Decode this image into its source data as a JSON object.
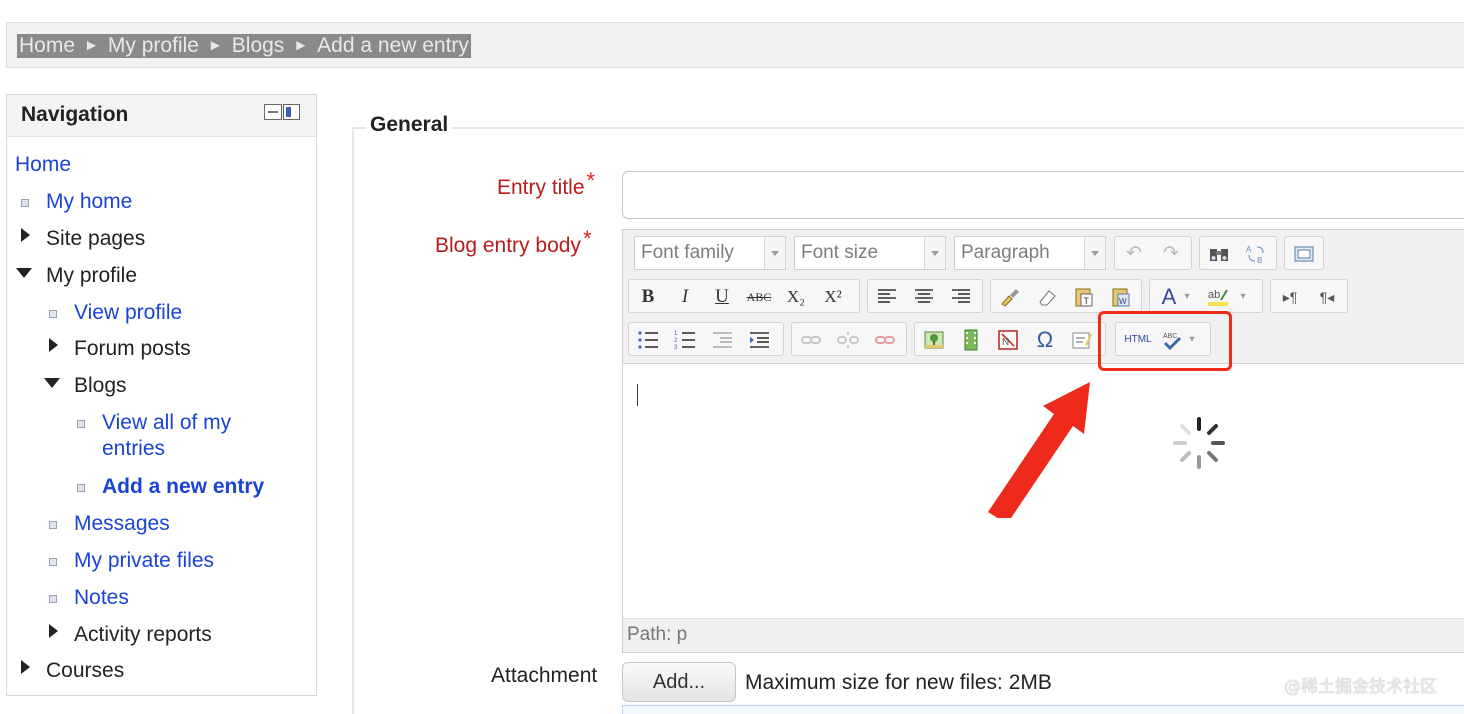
{
  "breadcrumb": {
    "items": [
      "Home",
      "My profile",
      "Blogs",
      "Add a new entry"
    ],
    "separator": "►"
  },
  "navigation": {
    "title": "Navigation",
    "home": "Home",
    "my_home": "My home",
    "site_pages": "Site pages",
    "my_profile": "My profile",
    "view_profile": "View profile",
    "forum_posts": "Forum posts",
    "blogs": "Blogs",
    "view_all_entries_line1": "View all of my",
    "view_all_entries_line2": "entries",
    "add_new_entry": "Add a new entry",
    "messages": "Messages",
    "private_files": "My private files",
    "notes": "Notes",
    "activity_reports": "Activity reports",
    "courses": "Courses"
  },
  "form": {
    "legend": "General",
    "entry_title_label": "Entry title",
    "entry_title_value": "",
    "body_label": "Blog entry body",
    "required_mark": "*",
    "attachment_label": "Attachment",
    "add_button": "Add...",
    "max_size": "Maximum size for new files: 2MB"
  },
  "editor": {
    "font_family": "Font family",
    "font_size": "Font size",
    "format": "Paragraph",
    "path": "Path: p",
    "buttons": {
      "bold": "B",
      "italic": "I",
      "underline": "U",
      "strikethrough": "ABC",
      "subscript": "X₂",
      "superscript": "X²",
      "omega": "Ω",
      "html": "HTML",
      "ltr": "▸¶",
      "rtl": "¶◂"
    }
  },
  "watermark": "@稀土掘金技术社区",
  "colors": {
    "link": "#1a44d6",
    "required": "#b71c1c",
    "highlight": "#ee2a1a"
  }
}
